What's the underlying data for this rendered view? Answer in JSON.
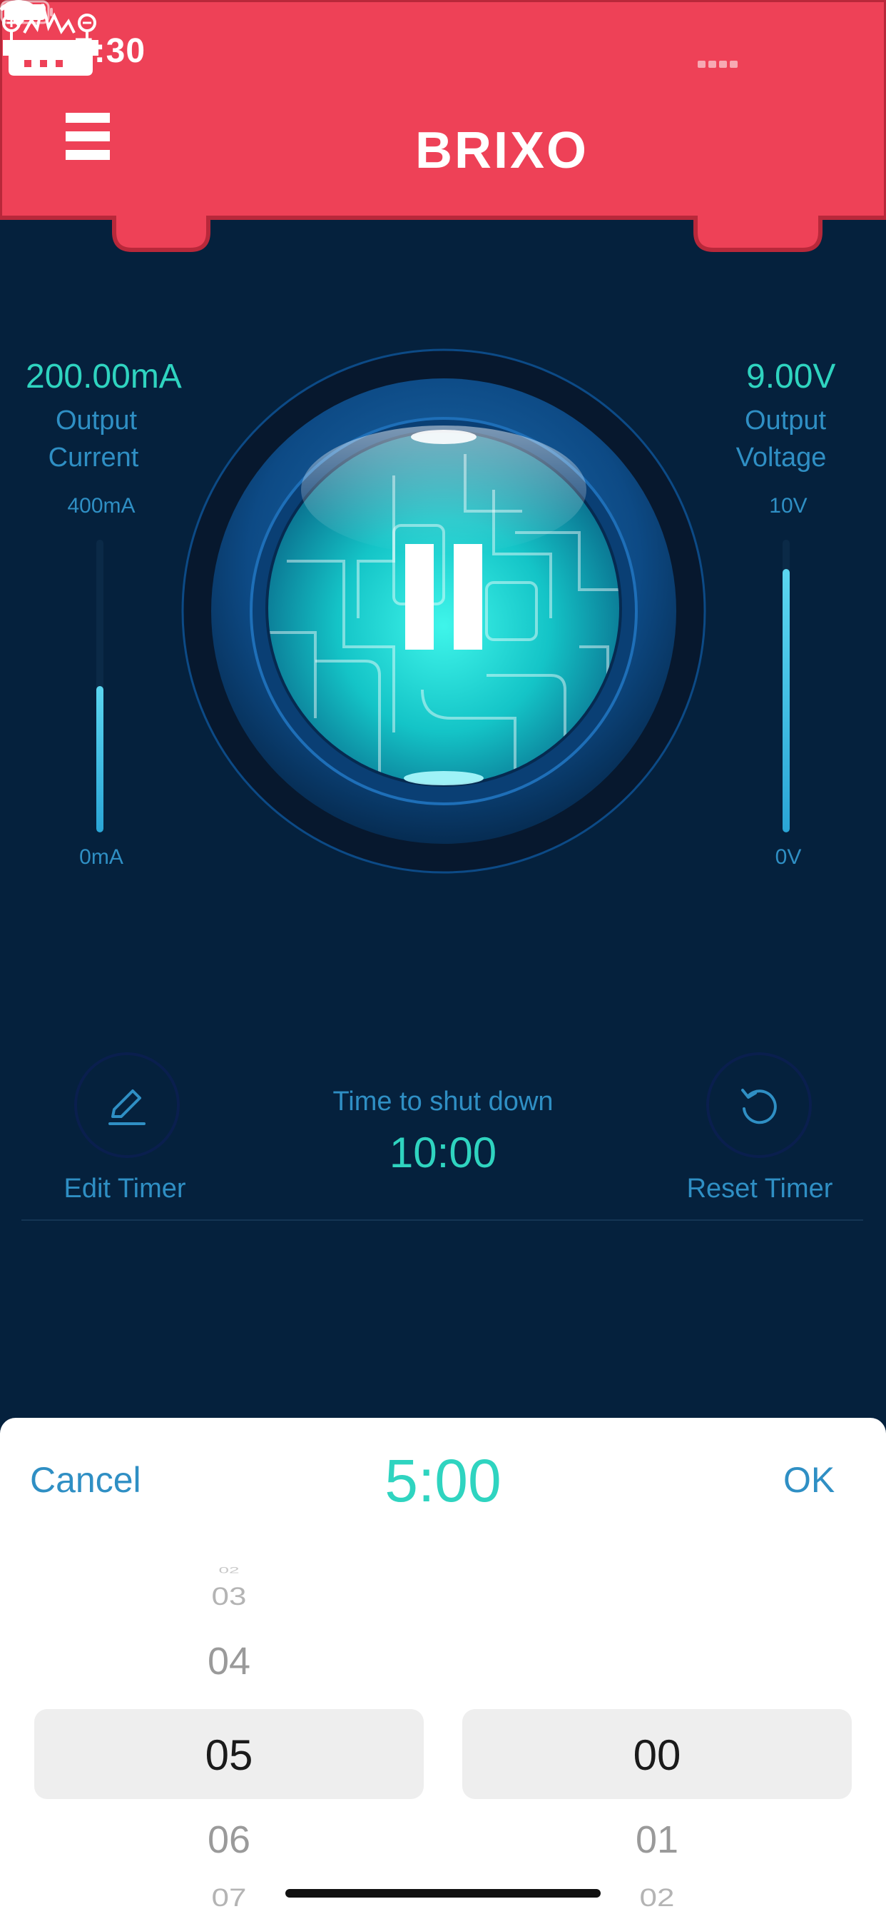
{
  "status_bar": {
    "time": "7:30"
  },
  "header": {
    "brand": "BRIXO",
    "bg_color": "#ee4157"
  },
  "current": {
    "value": "200.00mA",
    "label_line1": "Output",
    "label_line2": "Current",
    "max_label": "400mA",
    "min_label": "0mA",
    "level": 0.5
  },
  "voltage": {
    "value": "9.00V",
    "label_line1": "Output",
    "label_line2": "Voltage",
    "max_label": "10V",
    "min_label": "0V",
    "level": 0.9
  },
  "power_button": {
    "state": "paused",
    "icon": "pause-icon"
  },
  "timer": {
    "caption": "Time to shut down",
    "value": "10:00",
    "edit_label": "Edit Timer",
    "reset_label": "Reset Timer"
  },
  "picker": {
    "cancel_label": "Cancel",
    "ok_label": "OK",
    "selected_time": "5:00",
    "minutes": {
      "above": [
        "02",
        "03",
        "04"
      ],
      "selected": "05",
      "below": [
        "06",
        "07"
      ]
    },
    "seconds": {
      "selected": "00",
      "below": [
        "01",
        "02"
      ]
    }
  },
  "colors": {
    "background": "#05213d",
    "accent_teal": "#2fd4c0",
    "label_blue": "#2f8fc4",
    "header_red": "#ee4157"
  }
}
